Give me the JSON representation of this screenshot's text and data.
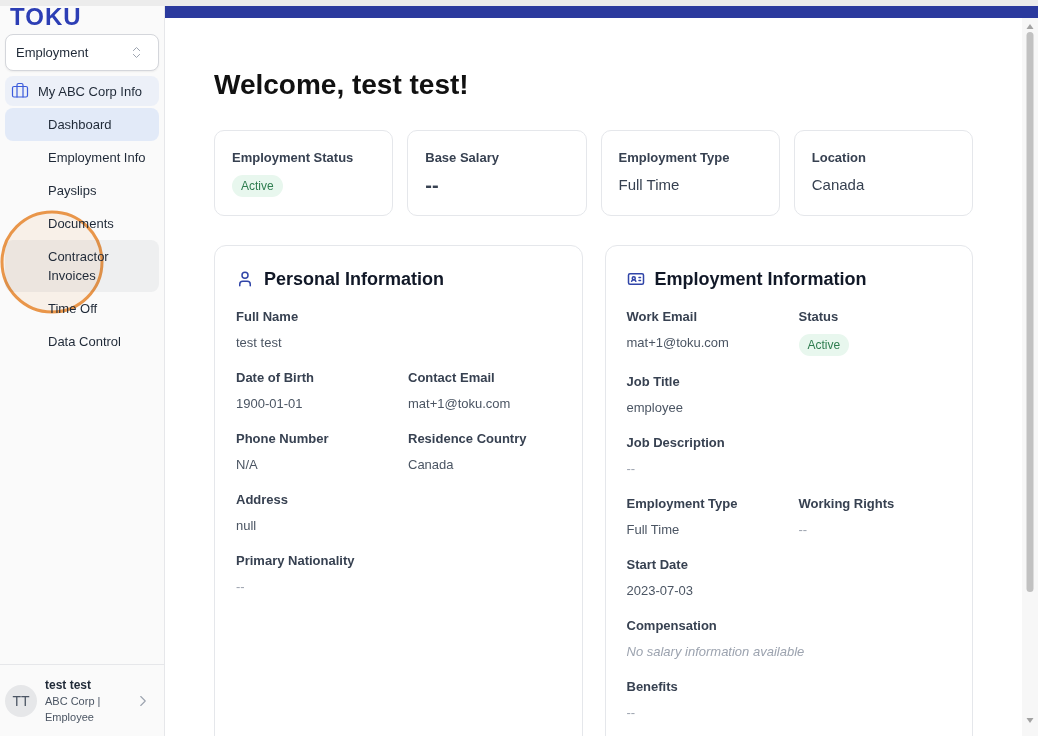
{
  "sidebar": {
    "logo": "TOKU",
    "section_select": {
      "value": "Employment"
    },
    "nav": {
      "label": "My ABC Corp Info",
      "items": [
        {
          "label": "Dashboard",
          "selected": true,
          "hovered": false
        },
        {
          "label": "Employment Info",
          "selected": false,
          "hovered": false
        },
        {
          "label": "Payslips",
          "selected": false,
          "hovered": false
        },
        {
          "label": "Documents",
          "selected": false,
          "hovered": false
        },
        {
          "label": "Contractor Invoices",
          "selected": false,
          "hovered": true
        },
        {
          "label": "Time Off",
          "selected": false,
          "hovered": false
        },
        {
          "label": "Data Control",
          "selected": false,
          "hovered": false
        }
      ]
    },
    "user": {
      "initials": "TT",
      "name": "test test",
      "details": "ABC Corp | Employee"
    }
  },
  "main": {
    "title": "Welcome, test test!",
    "summary_cards": [
      {
        "label": "Employment Status",
        "value": "Active",
        "kind": "badge"
      },
      {
        "label": "Base Salary",
        "value": "--",
        "kind": "large"
      },
      {
        "label": "Employment Type",
        "value": "Full Time",
        "kind": "text"
      },
      {
        "label": "Location",
        "value": "Canada",
        "kind": "text"
      }
    ],
    "panels": [
      {
        "title": "Personal Information",
        "kind": "person",
        "rows": [
          {
            "fields": [
              {
                "label": "Full Name",
                "value": "test test",
                "kind": "text"
              }
            ]
          },
          {
            "fields": [
              {
                "label": "Date of Birth",
                "value": "1900-01-01",
                "kind": "text"
              },
              {
                "label": "Contact Email",
                "value": "mat+1@toku.com",
                "kind": "text"
              }
            ]
          },
          {
            "fields": [
              {
                "label": "Phone Number",
                "value": "N/A",
                "kind": "text"
              },
              {
                "label": "Residence Country",
                "value": "Canada",
                "kind": "text"
              }
            ]
          },
          {
            "fields": [
              {
                "label": "Address",
                "value": "null",
                "kind": "text"
              }
            ]
          },
          {
            "fields": [
              {
                "label": "Primary Nationality",
                "value": "--",
                "kind": "empty"
              }
            ]
          }
        ]
      },
      {
        "title": "Employment Information",
        "kind": "id-card",
        "rows": [
          {
            "fields": [
              {
                "label": "Work Email",
                "value": "mat+1@toku.com",
                "kind": "text"
              },
              {
                "label": "Status",
                "value": "Active",
                "kind": "badge"
              }
            ]
          },
          {
            "fields": [
              {
                "label": "Job Title",
                "value": "employee",
                "kind": "text"
              }
            ]
          },
          {
            "fields": [
              {
                "label": "Job Description",
                "value": "--",
                "kind": "empty"
              }
            ]
          },
          {
            "fields": [
              {
                "label": "Employment Type",
                "value": "Full Time",
                "kind": "text"
              },
              {
                "label": "Working Rights",
                "value": "--",
                "kind": "empty"
              }
            ]
          },
          {
            "fields": [
              {
                "label": "Start Date",
                "value": "2023-07-03",
                "kind": "text"
              }
            ]
          },
          {
            "fields": [
              {
                "label": "Compensation",
                "value": "No salary information available",
                "kind": "note"
              }
            ]
          },
          {
            "fields": [
              {
                "label": "Benefits",
                "value": "--",
                "kind": "empty"
              }
            ]
          }
        ]
      }
    ]
  }
}
